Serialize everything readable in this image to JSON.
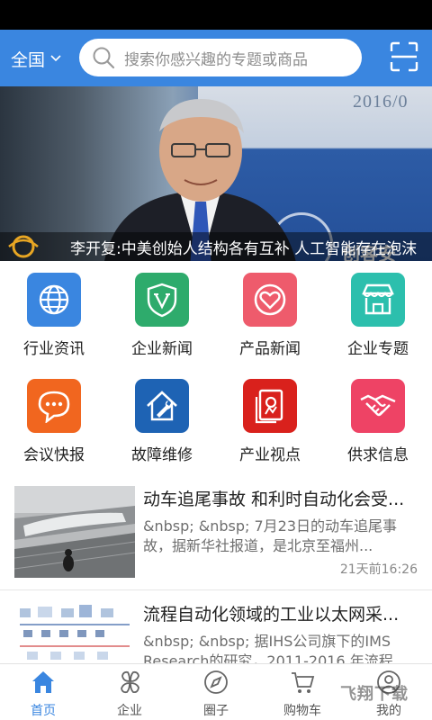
{
  "header": {
    "region_label": "全国",
    "search_placeholder": "搜索你感兴趣的专题或商品",
    "accent_color": "#3a86e0"
  },
  "banner": {
    "caption": "李开复:中美创始人结构各有互补 人工智能存在泡沫",
    "background_text_date": "2016/0",
    "background_text_brand": "创客安"
  },
  "categories": [
    {
      "label": "行业资讯",
      "icon": "globe-icon",
      "color": "#3a86e0"
    },
    {
      "label": "企业新闻",
      "icon": "v-shield-icon",
      "color": "#2eab6c"
    },
    {
      "label": "产品新闻",
      "icon": "heart-ring-icon",
      "color": "#ee5b6c"
    },
    {
      "label": "企业专题",
      "icon": "storefront-icon",
      "color": "#2cbfad"
    },
    {
      "label": "会议快报",
      "icon": "chat-bubble-icon",
      "color": "#f1661f"
    },
    {
      "label": "故障维修",
      "icon": "house-wrench-icon",
      "color": "#1e63b4"
    },
    {
      "label": "产业视点",
      "icon": "document-chart-icon",
      "color": "#d9211c"
    },
    {
      "label": "供求信息",
      "icon": "handshake-icon",
      "color": "#ee4365"
    }
  ],
  "news": [
    {
      "title": "动车追尾事故 和利时自动化会受...",
      "summary": "&nbsp; &nbsp; 7月23日的动车追尾事故，据新华社报道，是北京至福州...",
      "time": "21天前16:26"
    },
    {
      "title": "流程自动化领域的工业以太网采...",
      "summary": "&nbsp; &nbsp; 据IHS公司旗下的IMS Research的研究，2011-2016 年流程",
      "time": ""
    }
  ],
  "tabbar": {
    "items": [
      {
        "label": "首页",
        "icon": "home-icon",
        "active": true
      },
      {
        "label": "企业",
        "icon": "clover-icon",
        "active": false
      },
      {
        "label": "圈子",
        "icon": "compass-icon",
        "active": false
      },
      {
        "label": "购物车",
        "icon": "cart-icon",
        "active": false
      },
      {
        "label": "我的",
        "icon": "user-icon",
        "active": false
      }
    ]
  },
  "watermark": {
    "text": "飞翔下载"
  }
}
